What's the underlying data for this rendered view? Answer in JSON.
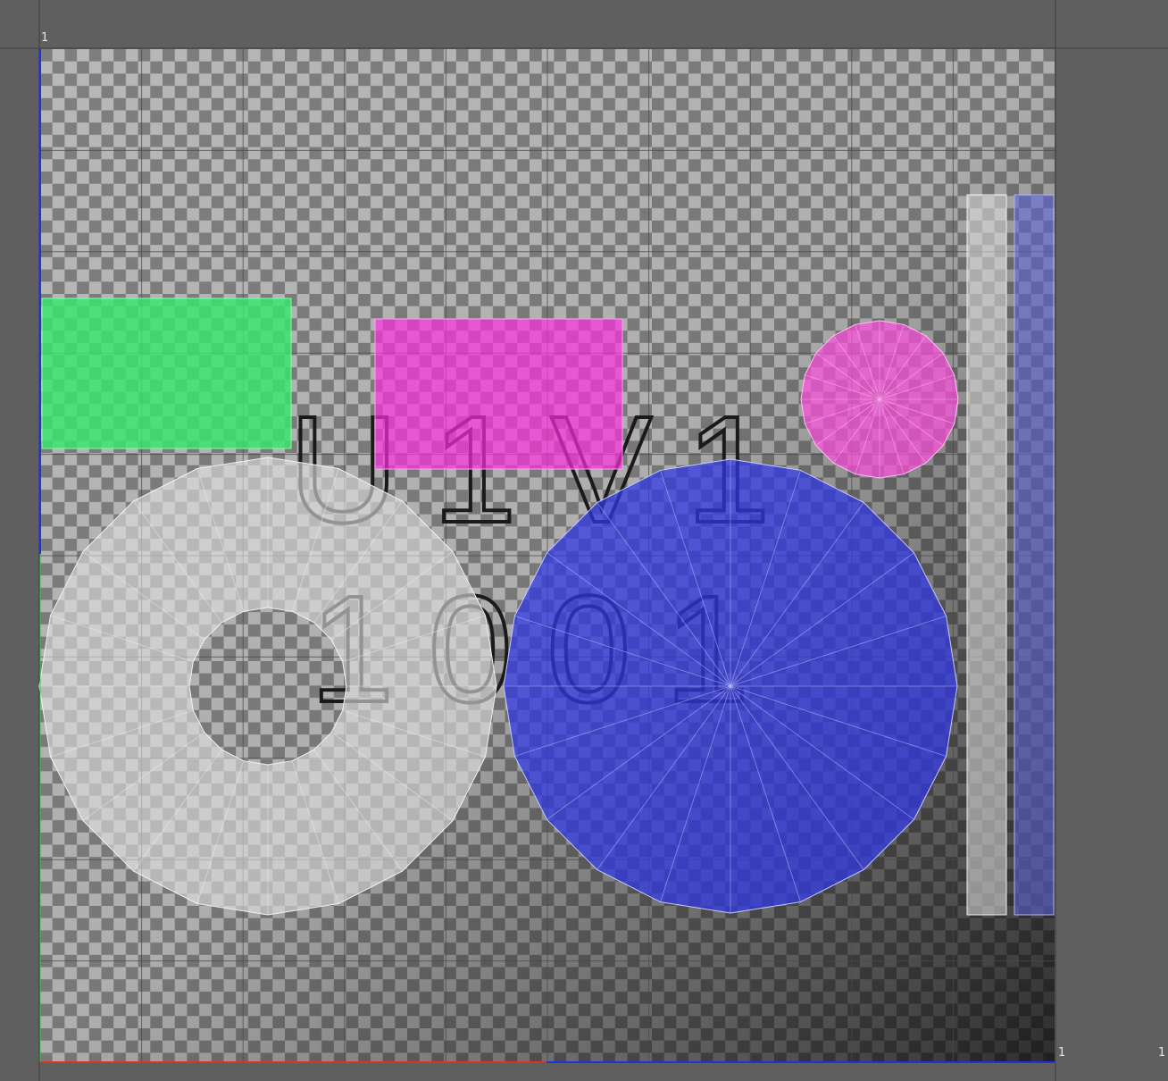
{
  "uv_editor": {
    "labels": {
      "top_left": "1",
      "bottom_right": "1",
      "far_right": "1"
    },
    "tile_text": {
      "line1": "U1V1",
      "line2": "1001"
    },
    "shells": [
      {
        "name": "green-rectangle",
        "color": "#00d13c"
      },
      {
        "name": "magenta-rectangle",
        "color": "#ff3fd8"
      },
      {
        "name": "pink-disc",
        "color": "#ff5fe0"
      },
      {
        "name": "gray-ring",
        "color": "#d8d8d8"
      },
      {
        "name": "blue-disc",
        "color": "#3a40e0"
      },
      {
        "name": "gray-strip",
        "color": "#dcdcdc"
      },
      {
        "name": "blue-strip",
        "color": "#6f78d8"
      }
    ],
    "axes": {
      "u_axis_color": "#e0301e",
      "v_axis_color": "#2430d8",
      "v_axis_left_color": "#24d84a"
    }
  }
}
